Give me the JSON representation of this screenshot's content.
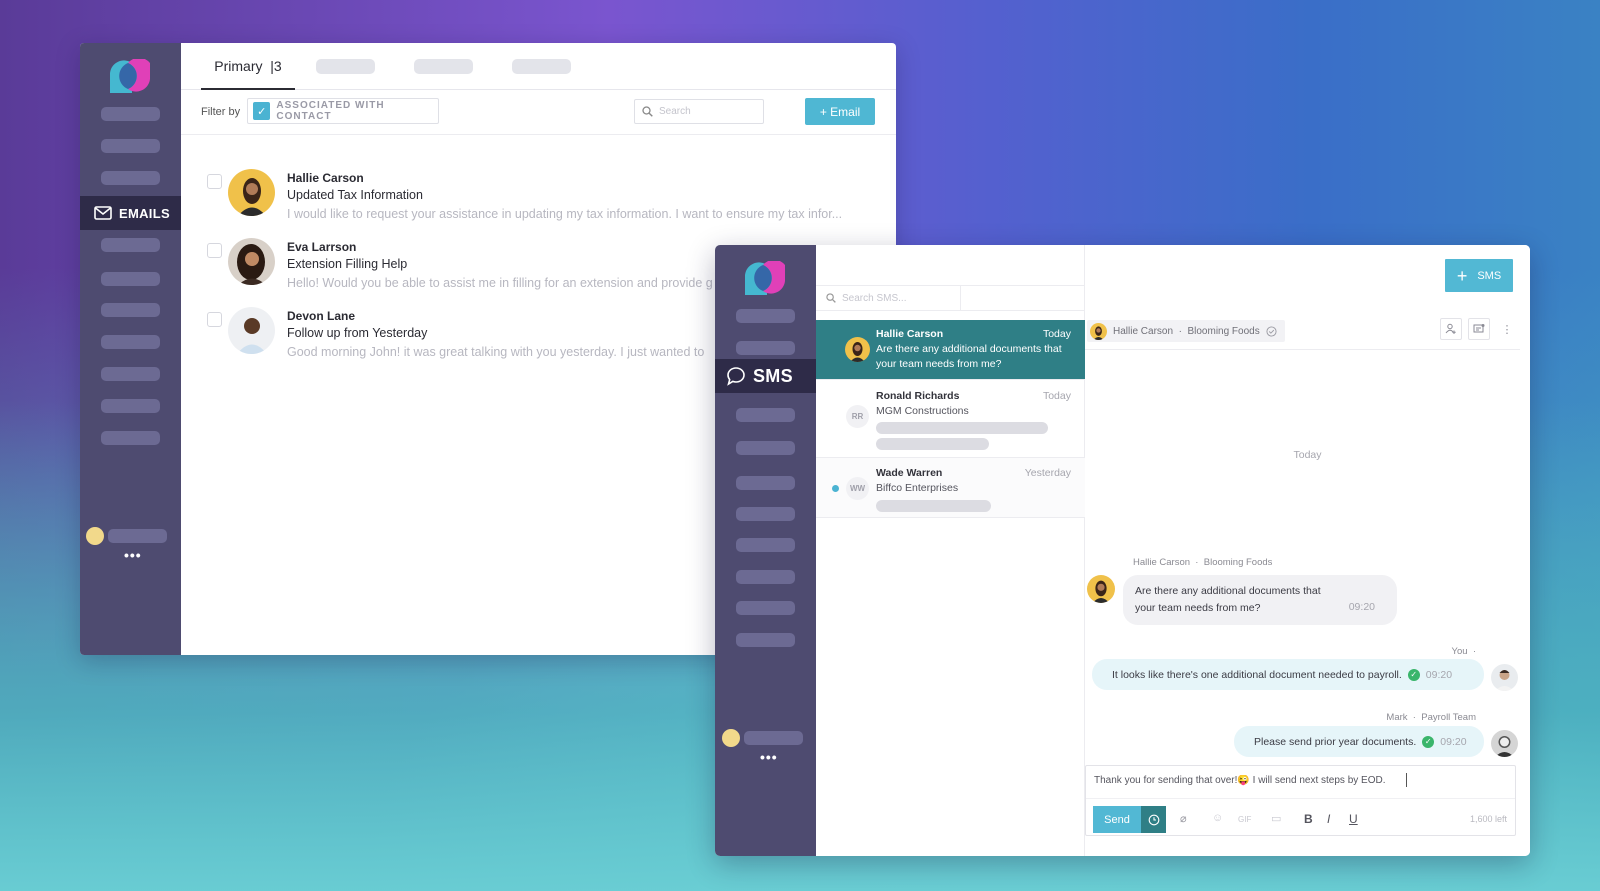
{
  "email_window": {
    "sidebar": {
      "active_item": {
        "label": "EMAILS",
        "icon": "mail-icon"
      },
      "more_label": "•••"
    },
    "tabs": [
      {
        "label": "Primary",
        "count": "3"
      }
    ],
    "tab_primary_label": "Primary  |3",
    "filter": {
      "label": "Filter by",
      "chip_label": "ASSOCIATED WITH CONTACT",
      "chip_checked": true
    },
    "search": {
      "placeholder": "Search",
      "value": ""
    },
    "new_email_button": "+ Email",
    "emails": [
      {
        "sender": "Hallie Carson",
        "subject": "Updated Tax Information",
        "preview": "I would like to request your assistance in updating my tax information. I want to ensure my tax infor..."
      },
      {
        "sender": "Eva Larrson",
        "subject": "Extension Filling Help",
        "preview": "Hello! Would you be able to assist me in filling for an extension and provide g"
      },
      {
        "sender": "Devon Lane",
        "subject": "Follow up from Yesterday",
        "preview": "Good morning John! it was great talking with you yesterday. I just wanted to"
      }
    ]
  },
  "sms_window": {
    "sidebar": {
      "active_item": {
        "label": "SMS",
        "icon": "chat-bubble-icon"
      },
      "more_label": "•••"
    },
    "search": {
      "placeholder": "Search SMS...",
      "value": ""
    },
    "threads": [
      {
        "name": "Hallie Carson",
        "time": "Today",
        "preview_line1": "Are there any additional documents that",
        "preview_line2": "your team needs from me?",
        "active": true
      },
      {
        "name": "Ronald Richards",
        "time": "Today",
        "company": "MGM Constructions",
        "initials": "RR"
      },
      {
        "name": "Wade Warren",
        "time": "Yesterday",
        "company": "Biffco Enterprises",
        "initials": "WW",
        "unread": true
      }
    ],
    "new_sms_button": "SMS",
    "conversation": {
      "contact_name": "Hallie Carson",
      "contact_company": "Blooming Foods",
      "contact_chip": "Hallie Carson  ·  Blooming Foods",
      "day_label": "Today",
      "messages": [
        {
          "direction": "in",
          "meta": "Hallie Carson  ·  Blooming Foods",
          "line1": "Are there any additional documents that",
          "line2": "your team needs from me?",
          "time": "09:20"
        },
        {
          "direction": "out",
          "meta": "You  ·",
          "text": "It looks like there's one additional document needed to payroll.",
          "time": "09:20",
          "status": "delivered"
        },
        {
          "direction": "out",
          "meta": "Mark  ·  Payroll Team",
          "text": "Please send prior year documents.",
          "time": "09:20",
          "status": "delivered"
        }
      ]
    },
    "composer": {
      "value": "Thank you for sending that over!😜 I will send next steps by EOD.",
      "send_label": "Send",
      "chars_left": "1,600 left",
      "format_bold": "B",
      "format_italic": "I",
      "format_underline": "U",
      "gif_label": "GIF"
    }
  },
  "colors": {
    "sidebar": "#4e4b70",
    "sidebar_active": "#2e2b48",
    "accent": "#4fb7d3",
    "active_thread": "#2f7f86",
    "delivered": "#3ab56b"
  }
}
